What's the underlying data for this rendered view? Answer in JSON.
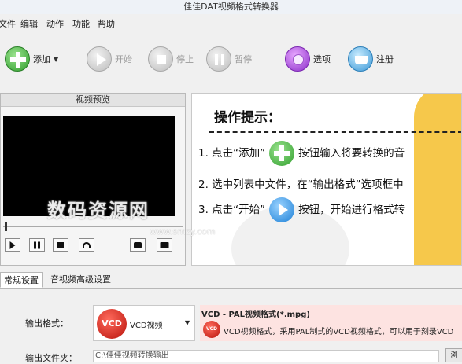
{
  "window": {
    "title": "佳佳DAT视频格式转换器"
  },
  "menu": [
    "文件",
    "编辑",
    "动作",
    "功能",
    "帮助"
  ],
  "toolbar": {
    "add": "添加",
    "start": "开始",
    "stop": "停止",
    "pause": "暂停",
    "options": "选项",
    "register": "注册"
  },
  "preview": {
    "title": "视频预览"
  },
  "tips": {
    "title": "操作提示：",
    "line1_pre": "1. 点击“添加”",
    "line1_post": "按钮输入将要转换的音",
    "line2": "2. 选中列表中文件，在“输出格式”选项框中",
    "line3_pre": "3. 点击“开始”",
    "line3_post": "按钮，开始进行格式转"
  },
  "watermark": {
    "text": "数码资源网",
    "sub": "www.smzy.com"
  },
  "tabs": [
    "常规设置",
    "音视频高级设置"
  ],
  "settings": {
    "format_label": "输出格式：",
    "format_logo": "VCD",
    "format_value": "VCD视频",
    "format_desc_title": "VCD - PAL视频格式(*.mpg)",
    "format_desc_text": "VCD视频格式，采用PAL制式的VCD视频格式，可以用于刻录VCD",
    "output_label": "输出文件夹：",
    "output_value": "C:\\佳佳视频转换输出",
    "browse_label": "浏"
  }
}
